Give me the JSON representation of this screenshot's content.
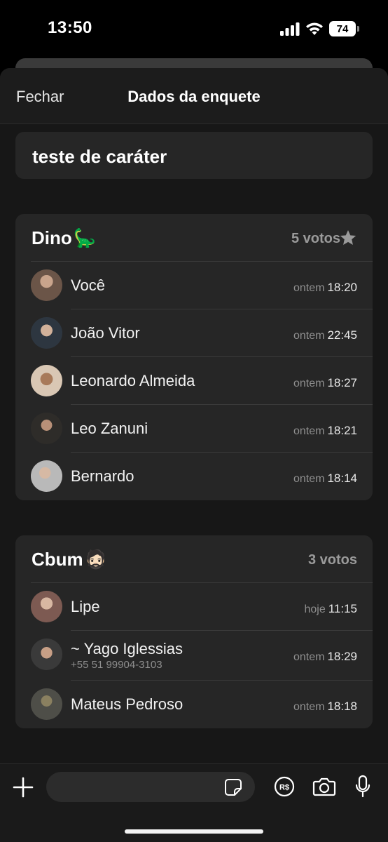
{
  "status": {
    "time": "13:50",
    "battery": "74"
  },
  "nav": {
    "close_label": "Fechar",
    "title": "Dados da enquete"
  },
  "question": "teste de caráter",
  "options": [
    {
      "name": "Dino",
      "emoji": "🦕",
      "votes_label": "5 votos",
      "winner_icon": "star-icon",
      "voters": [
        {
          "name": "Você",
          "day": "ontem",
          "time": "18:20",
          "avatar_color": "#6b5548"
        },
        {
          "name": "João Vitor",
          "day": "ontem",
          "time": "22:45",
          "avatar_color": "#3f4a55"
        },
        {
          "name": "Leonardo Almeida",
          "day": "ontem",
          "time": "18:27",
          "avatar_color": "#b58e6b"
        },
        {
          "name": "Leo Zanuni",
          "day": "ontem",
          "time": "18:21",
          "avatar_color": "#3d3b37"
        },
        {
          "name": "Bernardo",
          "day": "ontem",
          "time": "18:14",
          "avatar_color": "#9b9b9b"
        }
      ]
    },
    {
      "name": "Cbum",
      "emoji": "🧔🏻",
      "votes_label": "3 votos",
      "voters": [
        {
          "name": "Lipe",
          "day": "hoje",
          "time": "11:15",
          "avatar_color": "#8a6f64"
        },
        {
          "name": "~ Yago Iglessias",
          "phone": "+55 51 99904-3103",
          "day": "ontem",
          "time": "18:29",
          "avatar_color": "#4a4a4a"
        },
        {
          "name": "Mateus Pedroso",
          "day": "ontem",
          "time": "18:18",
          "avatar_color": "#5a5a52"
        }
      ]
    }
  ],
  "colors": {
    "sheet": "#171717",
    "card": "#262626",
    "muted": "#8e8e8e",
    "separator": "#3a3a3a"
  }
}
